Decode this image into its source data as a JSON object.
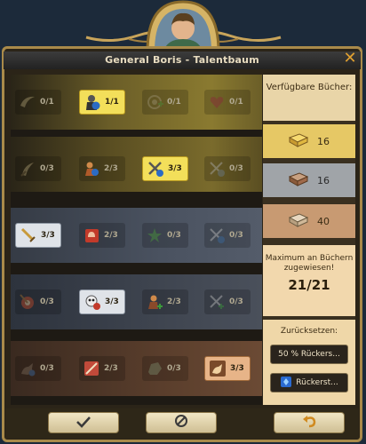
{
  "window": {
    "title": "General Boris  - Talentbaum",
    "close_glyph": "✕"
  },
  "rows": [
    {
      "tier": "gold",
      "talents": [
        {
          "icon": "boomerang-icon",
          "value": "0/1",
          "state": "inactive"
        },
        {
          "icon": "knight-shield-icon",
          "value": "1/1",
          "state": "active"
        },
        {
          "icon": "target-plus-icon",
          "value": "0/1",
          "state": "inactive"
        },
        {
          "icon": "heart-icon",
          "value": "0/1",
          "state": "inactive"
        }
      ]
    },
    {
      "tier": "gold",
      "talents": [
        {
          "icon": "sword-slash-icon",
          "value": "0/3",
          "state": "inactive"
        },
        {
          "icon": "fighter-icon",
          "value": "2/3",
          "state": "inactive"
        },
        {
          "icon": "crossed-swords-icon",
          "value": "3/3",
          "state": "active"
        },
        {
          "icon": "crossed-swords-clock-icon",
          "value": "0/3",
          "state": "inactive"
        }
      ]
    },
    {
      "tier": "silver",
      "talents": [
        {
          "icon": "sword-icon",
          "value": "3/3",
          "state": "active-silver"
        },
        {
          "icon": "fist-icon",
          "value": "2/3",
          "state": "inactive"
        },
        {
          "icon": "green-star-icon",
          "value": "0/3",
          "state": "inactive"
        },
        {
          "icon": "crossed-swords-plus-icon",
          "value": "0/3",
          "state": "inactive"
        }
      ]
    },
    {
      "tier": "silver",
      "talents": [
        {
          "icon": "target-arrow-icon",
          "value": "0/3",
          "state": "inactive"
        },
        {
          "icon": "skull-icon",
          "value": "3/3",
          "state": "active-silver"
        },
        {
          "icon": "warrior-plus-icon",
          "value": "2/3",
          "state": "inactive"
        },
        {
          "icon": "crossed-swords-heal-icon",
          "value": "0/3",
          "state": "inactive"
        }
      ]
    },
    {
      "tier": "bronze",
      "talents": [
        {
          "icon": "horseman-icon",
          "value": "0/3",
          "state": "inactive"
        },
        {
          "icon": "broken-arrow-icon",
          "value": "2/3",
          "state": "inactive"
        },
        {
          "icon": "stone-icon",
          "value": "0/3",
          "state": "inactive"
        },
        {
          "icon": "cavalry-icon",
          "value": "3/3",
          "state": "active-bronze"
        }
      ]
    }
  ],
  "sidebar": {
    "available_books_label": "Verfügbare Bücher:",
    "books": [
      {
        "tier": "gold",
        "count": "16"
      },
      {
        "tier": "silver",
        "count": "16"
      },
      {
        "tier": "bronze",
        "count": "40"
      }
    ],
    "max_text": "Maximum an Büchern zugewiesen!",
    "assigned_count": "21/21",
    "reset_label": "Zurücksetzen:",
    "reset_buttons": [
      {
        "label": "50 % Rückers..."
      },
      {
        "label": "Rückerst..."
      }
    ]
  },
  "colors": {
    "accent_gold": "#e0a030",
    "frame": "#a98a4a"
  },
  "footer": {
    "ok_icon": "checkmark-icon",
    "cancel_icon": "no-entry-icon",
    "undo_icon": "undo-arrow-icon"
  }
}
